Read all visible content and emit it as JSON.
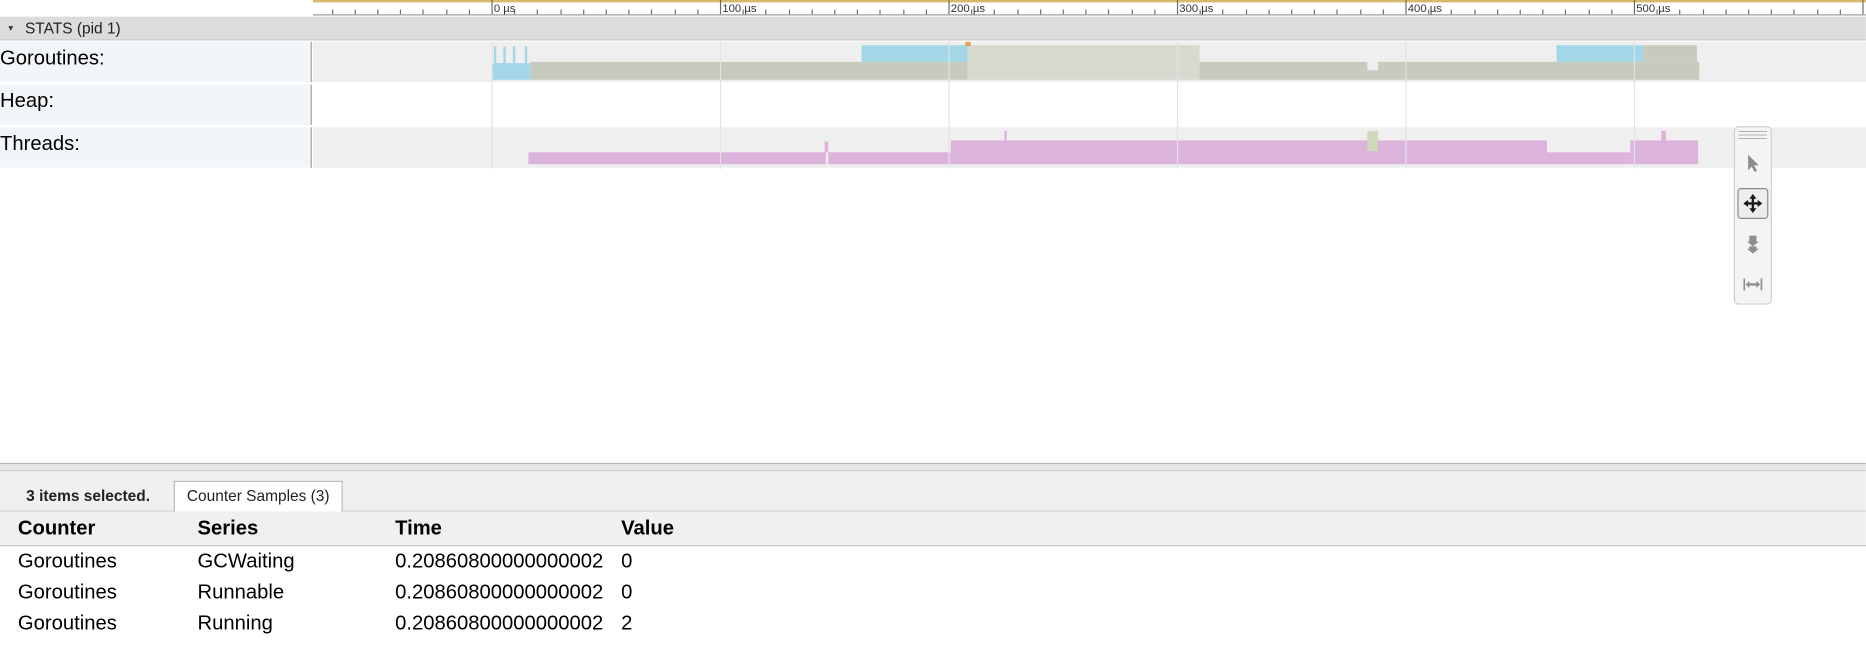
{
  "timeline": {
    "tick_labels": [
      "0 µs",
      "100 µs",
      "200 µs",
      "300 µs",
      "400 µs",
      "500 µs"
    ]
  },
  "process": {
    "title": "STATS (pid 1)",
    "expander": "▾"
  },
  "tracks": [
    {
      "label": "Goroutines:"
    },
    {
      "label": "Heap:"
    },
    {
      "label": "Threads:"
    }
  ],
  "colors": {
    "goroutines_runnable": "#a3d7e8",
    "goroutines_running": "#c6cbbd",
    "goroutines_running_selected": "#d6dad0",
    "threads": "#dcb3db",
    "track_shaded": "#efefef",
    "ruler_accent": "#d7b76a"
  },
  "tools": [
    {
      "name": "selection-tool",
      "icon": "cursor-arrow-icon",
      "active": false
    },
    {
      "name": "pan-tool",
      "icon": "move-arrows-icon",
      "active": true
    },
    {
      "name": "zoom-tool",
      "icon": "zoom-vertical-icon",
      "active": false
    },
    {
      "name": "timing-tool",
      "icon": "horizontal-range-icon",
      "active": false
    }
  ],
  "analysis": {
    "selection_summary": "3 items selected.",
    "tab_label": "Counter Samples (3)",
    "columns": [
      "Counter",
      "Series",
      "Time",
      "Value"
    ],
    "rows": [
      [
        "Goroutines",
        "GCWaiting",
        "0.20860800000000002",
        "0"
      ],
      [
        "Goroutines",
        "Runnable",
        "0.20860800000000002",
        "0"
      ],
      [
        "Goroutines",
        "Running",
        "0.20860800000000002",
        "2"
      ]
    ]
  }
}
